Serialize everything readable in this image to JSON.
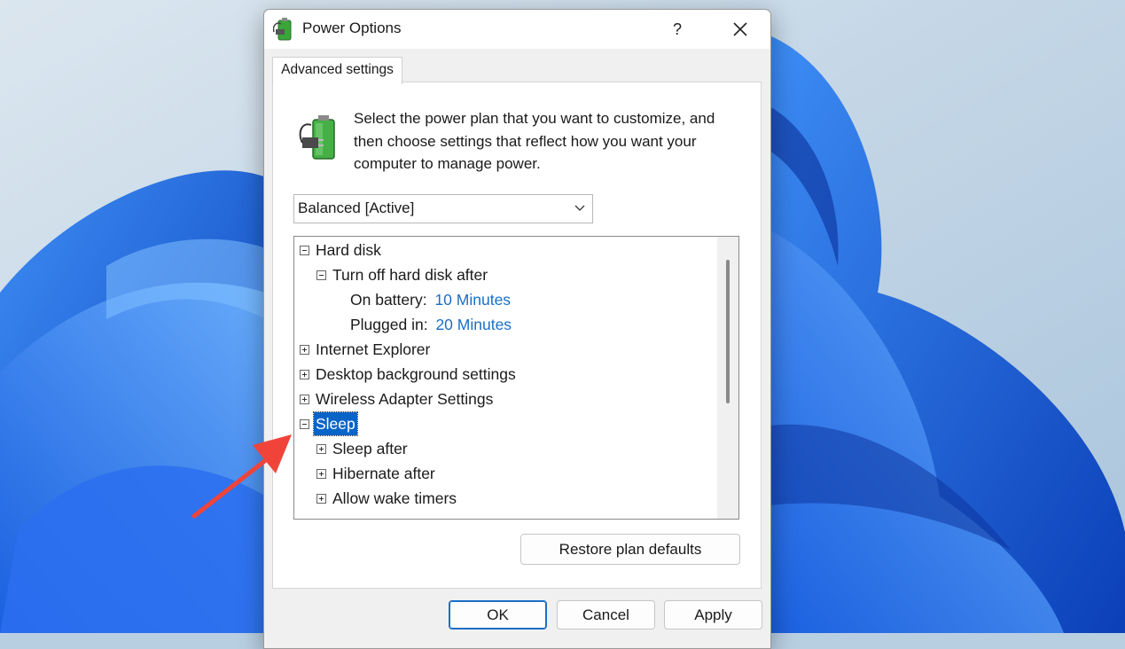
{
  "window": {
    "title": "Power Options",
    "help_label": "?",
    "close_icon": "close-icon",
    "app_icon": "power-options-icon"
  },
  "tab": {
    "label": "Advanced settings"
  },
  "description": "Select the power plan that you want to customize, and then choose settings that reflect how you want your computer to manage power.",
  "plan_select": {
    "value": "Balanced [Active]"
  },
  "tree": {
    "rows": [
      {
        "label": "Hard disk",
        "expanded": true,
        "level": 0
      },
      {
        "label": "Turn off hard disk after",
        "expanded": true,
        "level": 1
      },
      {
        "label": "On battery:",
        "value": "10 Minutes",
        "level": 2
      },
      {
        "label": "Plugged in:",
        "value": "20 Minutes",
        "level": 2
      },
      {
        "label": "Internet Explorer",
        "expanded": false,
        "level": 0
      },
      {
        "label": "Desktop background settings",
        "expanded": false,
        "level": 0
      },
      {
        "label": "Wireless Adapter Settings",
        "expanded": false,
        "level": 0
      },
      {
        "label": "Sleep",
        "expanded": true,
        "selected": true,
        "level": 0
      },
      {
        "label": "Sleep after",
        "expanded": false,
        "level": 1
      },
      {
        "label": "Hibernate after",
        "expanded": false,
        "level": 1
      },
      {
        "label": "Allow wake timers",
        "expanded": false,
        "level": 1
      }
    ]
  },
  "buttons": {
    "restore": "Restore plan defaults",
    "ok": "OK",
    "cancel": "Cancel",
    "apply": "Apply"
  },
  "colors": {
    "selection": "#0a64c8",
    "link_value": "#1a6fc4",
    "annotation_arrow": "#f0443a"
  }
}
